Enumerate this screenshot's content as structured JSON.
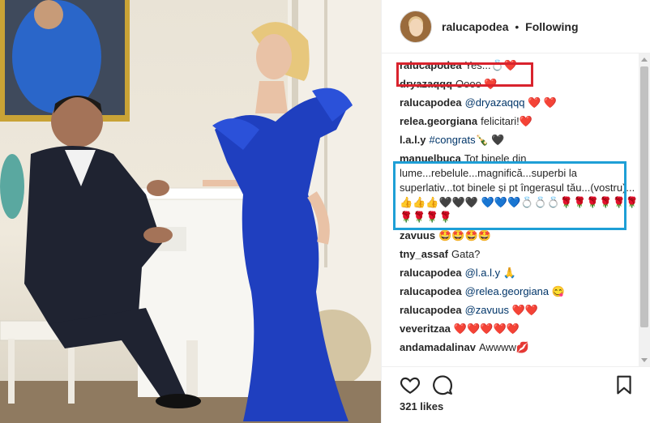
{
  "post": {
    "author": "ralucapodea",
    "separator": "•",
    "follow_status": "Following",
    "likes": "321 likes"
  },
  "comments": [
    {
      "user": "ralucapodea",
      "text": "Yes...💍❤️"
    },
    {
      "user": "dryazaqqq",
      "text": "Oooo ❤️"
    },
    {
      "user": "ralucapodea",
      "mention": "@dryazaqqq",
      "text": " ❤️ ❤️"
    },
    {
      "user": "relea.georgiana",
      "text": "felicitari!❤️"
    },
    {
      "user": "l.a.l.y",
      "mention": "#congrats",
      "text": "🍾 🖤"
    },
    {
      "user": "manuelbuca",
      "text": "Tot binele din lume...rebelule...magnifică...superbi la superlativ...tot binele și pt îngerașul tău...(vostru)...👍👍👍🖤🖤🖤 💙💙💙💍💍💍🌹🌹🌹🌹🌹🌹🌹🌹🌹🌹"
    },
    {
      "user": "zavuus",
      "text": "🤩🤩🤩🤩"
    },
    {
      "user": "tny_assaf",
      "text": "Gata?"
    },
    {
      "user": "ralucapodea",
      "mention": "@l.a.l.y",
      "text": " 🙏"
    },
    {
      "user": "ralucapodea",
      "mention": "@relea.georgiana",
      "text": " 😋"
    },
    {
      "user": "ralucapodea",
      "mention": "@zavuus",
      "text": " ❤️❤️"
    },
    {
      "user": "veveritzaa",
      "text": "❤️❤️❤️❤️❤️"
    },
    {
      "user": "andamadalinav",
      "text": "Awwww💋"
    }
  ],
  "icons": {
    "like": "heart-outline-icon",
    "comment": "comment-bubble-icon",
    "save": "bookmark-icon"
  },
  "colors": {
    "highlight_red": "#d9232d",
    "highlight_blue": "#1e9fd6",
    "dress_blue": "#1f3fbf",
    "mention": "#003569"
  }
}
